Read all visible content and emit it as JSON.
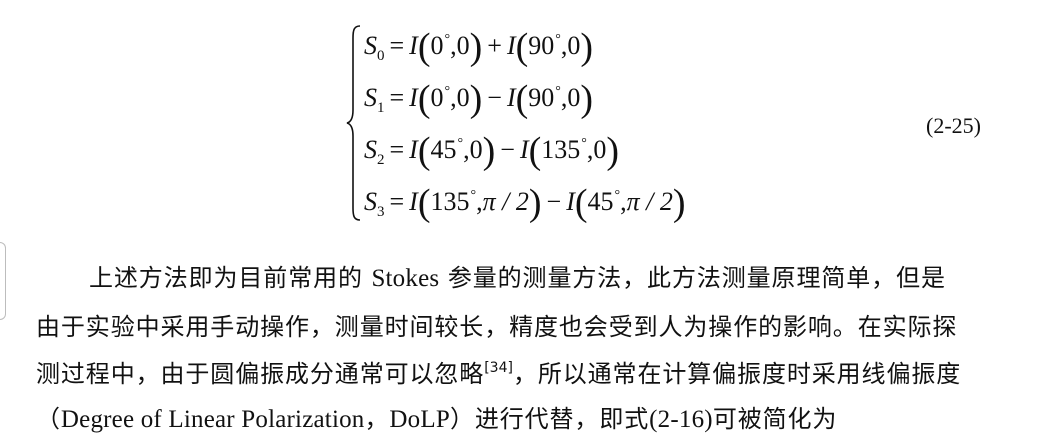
{
  "equation": {
    "number": "(2-25)",
    "lines": [
      {
        "lhs": "S",
        "lhs_sub": "0",
        "t1_func": "I",
        "t1_angle": "0",
        "t1_phase": "0",
        "op": "+",
        "t2_func": "I",
        "t2_angle": "90",
        "t2_phase": "0"
      },
      {
        "lhs": "S",
        "lhs_sub": "1",
        "t1_func": "I",
        "t1_angle": "0",
        "t1_phase": "0",
        "op": "−",
        "t2_func": "I",
        "t2_angle": "90",
        "t2_phase": "0"
      },
      {
        "lhs": "S",
        "lhs_sub": "2",
        "t1_func": "I",
        "t1_angle": "45",
        "t1_phase": "0",
        "op": "−",
        "t2_func": "I",
        "t2_angle": "135",
        "t2_phase": "0"
      },
      {
        "lhs": "S",
        "lhs_sub": "3",
        "t1_func": "I",
        "t1_angle": "135",
        "t1_phase": "π / 2",
        "op": "−",
        "t2_func": "I",
        "t2_angle": "45",
        "t2_phase": "π / 2"
      }
    ]
  },
  "paragraph": {
    "line1_a": "上述方法即为目前常用的 ",
    "line1_stokes": "Stokes",
    "line1_b": " 参量的测量方法，此方法测量原理简单，但是",
    "line2": "由于实验中采用手动操作，测量时间较长，精度也会受到人为操作的影响。在实际探",
    "line3_a": "测过程中，由于圆偏振成分通常可以忽略",
    "line3_cite": "[34]",
    "line3_b": "，所以通常在计算偏振度时采用线偏振度",
    "line4_a": "（",
    "line4_term": "Degree of Linear Polarization",
    "line4_b": "，",
    "line4_abbr": "DoLP",
    "line4_c": "）进行代替，即式",
    "line4_ref": "(2-16)",
    "line4_d": "可被简化为"
  }
}
